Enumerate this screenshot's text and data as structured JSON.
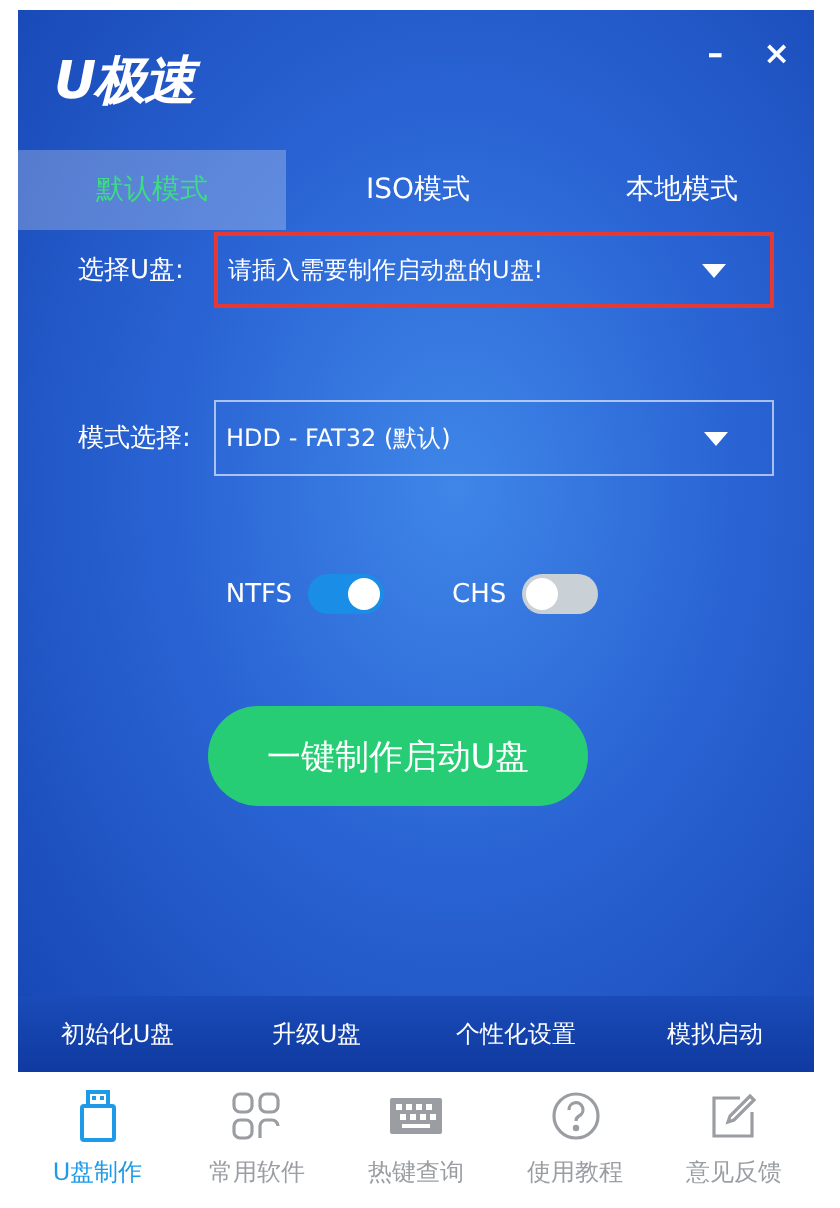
{
  "window": {
    "logo_text": "U极速",
    "controls": [
      "–",
      "×"
    ]
  },
  "tabs": [
    {
      "label": "默认模式",
      "selected": true
    },
    {
      "label": "ISO模式",
      "selected": false
    },
    {
      "label": "本地模式",
      "selected": false
    }
  ],
  "fields": [
    {
      "label": "选择U盘:",
      "value": "请插入需要制作启动盘的U盘!",
      "highlighted": true
    },
    {
      "label": "模式选择:",
      "value": "HDD - FAT32 (默认)",
      "highlighted": false
    }
  ],
  "switches": [
    {
      "label": "NTFS",
      "on": true
    },
    {
      "label": "CHS",
      "on": false
    }
  ],
  "primary_button": "一键制作启动U盘",
  "links": [
    "初始化U盘",
    "升级U盘",
    "个性化设置",
    "模拟启动"
  ],
  "nav": [
    {
      "label": "U盘制作",
      "selected": true
    },
    {
      "label": "常用软件",
      "selected": false
    },
    {
      "label": "热键查询",
      "selected": false
    },
    {
      "label": "使用教程",
      "selected": false
    },
    {
      "label": "意见反馈",
      "selected": false
    }
  ]
}
